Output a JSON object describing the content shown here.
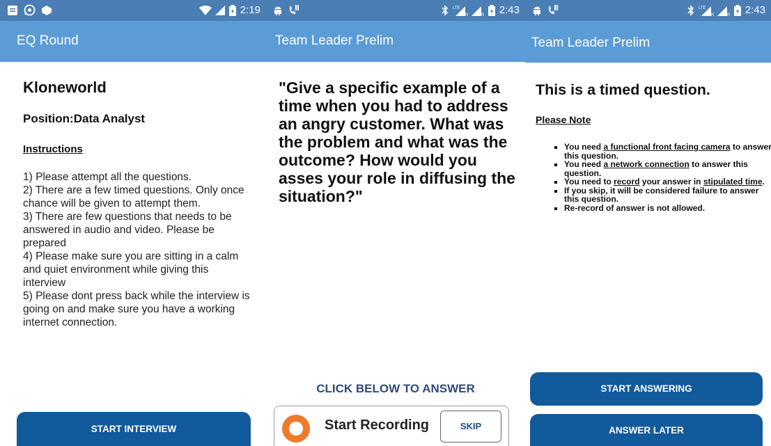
{
  "screens": [
    {
      "status": {
        "time": "2:19"
      },
      "appbar": {
        "title": "EQ Round"
      },
      "company": "Kloneworld",
      "position": "Position:Data Analyst",
      "instructions_heading": "Instructions",
      "instructions": [
        "1) Please attempt all the questions.",
        "2) There are a few timed questions. Only once chance will be given to attempt them.",
        "3) There are few questions that needs to be answered in audio and video. Please be prepared",
        "4) Please make sure you are sitting in a calm and quiet environment while giving this interview",
        "5) Please dont press back while the interview is going on and make sure you have a working internet connection."
      ],
      "button_label": "START INTERVIEW"
    },
    {
      "status": {
        "time": "2:43"
      },
      "appbar": {
        "title": "Team Leader Prelim"
      },
      "question": "\"Give a specific example of a time when you had to address an angry customer. What was the problem and what was the outcome? How would you asses your role in diffusing the situation?\"",
      "click_below": "CLICK BELOW TO ANSWER",
      "record_label": "Start Recording",
      "skip_label": "SKIP"
    },
    {
      "status": {
        "time": "2:43"
      },
      "appbar": {
        "title": "Team Leader Prelim"
      },
      "timed_title": "This is a timed question.",
      "please_note": "Please Note",
      "notes": {
        "n1_pre": "You need ",
        "n1_u": "a functional front facing camera",
        "n1_post": " to answer this question.",
        "n2_pre": "You need ",
        "n2_u": "a network connection",
        "n2_post": " to answer this question.",
        "n3_pre": "You need to ",
        "n3_u1": "record",
        "n3_mid": " your answer in ",
        "n3_u2": "stipulated time",
        "n3_post": ".",
        "n4": "If you skip, it will be considered failure to answer this question.",
        "n5": "Re-record of answer is not allowed."
      },
      "start_answering_label": "START ANSWERING",
      "answer_later_label": "ANSWER LATER"
    }
  ],
  "colors": {
    "status_bar": "#4a7eb5",
    "app_bar": "#5b9bd6",
    "primary_button": "#115a9b",
    "record_dot": "#ef7a2b"
  },
  "icons": {
    "screen1_status_left": [
      "notification-icon",
      "whatsapp-icon",
      "dot-icon"
    ],
    "screen1_status_right": [
      "wifi-icon",
      "signal-icon",
      "battery-icon"
    ],
    "screen23_status_left": [
      "android-icon",
      "missed-call-icon"
    ],
    "screen23_status_right": [
      "bluetooth-icon",
      "lte-signal-icon",
      "signal-icon",
      "battery-icon"
    ]
  }
}
